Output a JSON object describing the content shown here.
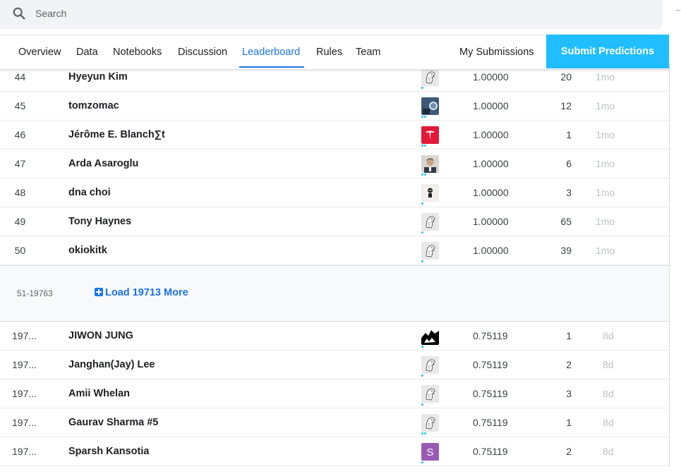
{
  "search": {
    "placeholder": "Search",
    "value": ""
  },
  "tabs": [
    "Overview",
    "Data",
    "Notebooks",
    "Discussion",
    "Leaderboard",
    "Rules",
    "Team"
  ],
  "active_tab": "Leaderboard",
  "my_submissions_label": "My Submissions",
  "submit_label": "Submit Predictions",
  "colors": {
    "accent": "#20beff",
    "link": "#1a73e8",
    "muted": "#bdc1c6"
  },
  "rows_top": [
    {
      "rank": "44",
      "name": "Hyeyun Kim",
      "avatar": "default",
      "dots": 1,
      "score": "1.00000",
      "entries": "20",
      "last": "1mo"
    },
    {
      "rank": "45",
      "name": "tomzomac",
      "avatar": "photo-blue",
      "dots": 2,
      "score": "1.00000",
      "entries": "12",
      "last": "1mo"
    },
    {
      "rank": "46",
      "name": "Jérôme E. Blanch∑t",
      "avatar": "tesla-logo",
      "dots": 2,
      "score": "1.00000",
      "entries": "1",
      "last": "1mo"
    },
    {
      "rank": "47",
      "name": "Arda Asaroglu",
      "avatar": "photo-person",
      "dots": 2,
      "score": "1.00000",
      "entries": "6",
      "last": "1mo"
    },
    {
      "rank": "48",
      "name": "dna choi",
      "avatar": "mono-figure",
      "dots": 1,
      "score": "1.00000",
      "entries": "3",
      "last": "1mo"
    },
    {
      "rank": "49",
      "name": "Tony Haynes",
      "avatar": "default",
      "dots": 1,
      "score": "1.00000",
      "entries": "65",
      "last": "1mo"
    },
    {
      "rank": "50",
      "name": "okiokitk",
      "avatar": "default",
      "dots": 1,
      "score": "1.00000",
      "entries": "39",
      "last": "1mo"
    }
  ],
  "load_more": {
    "range": "51-19763",
    "label": "Load 19713 More"
  },
  "rows_bottom": [
    {
      "rank": "197...",
      "name": "JIWON JUNG",
      "avatar": "black-white",
      "dots": 1,
      "score": "0.75119",
      "entries": "1",
      "last": "8d"
    },
    {
      "rank": "197...",
      "name": "Janghan(Jay) Lee",
      "avatar": "default",
      "dots": 1,
      "score": "0.75119",
      "entries": "2",
      "last": "8d"
    },
    {
      "rank": "197...",
      "name": "Amii Whelan",
      "avatar": "default",
      "dots": 1,
      "score": "0.75119",
      "entries": "3",
      "last": "8d"
    },
    {
      "rank": "197...",
      "name": "Gaurav Sharma #5",
      "avatar": "default",
      "dots": 2,
      "score": "0.75119",
      "entries": "1",
      "last": "8d"
    },
    {
      "rank": "197...",
      "name": "Sparsh Kansotia",
      "avatar": "letter-s",
      "avatar_letter": "S",
      "dots": 1,
      "score": "0.75119",
      "entries": "2",
      "last": "8d"
    }
  ]
}
